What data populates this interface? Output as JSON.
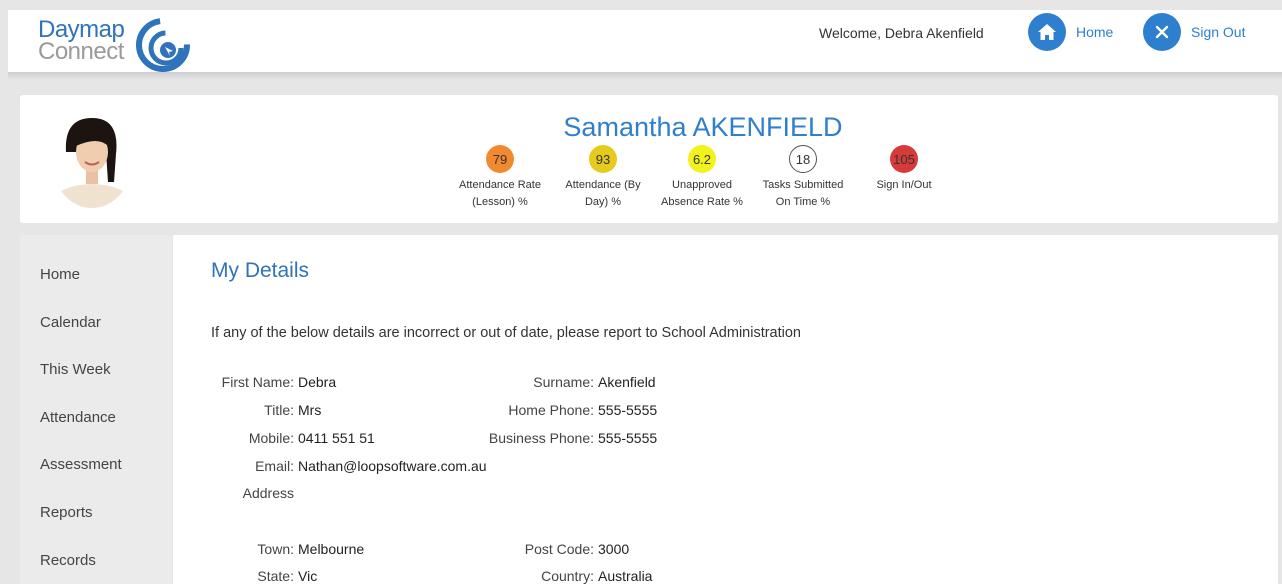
{
  "header": {
    "logo_line1": "Daymap",
    "logo_line2": "Connect",
    "welcome": "Welcome, Debra Akenfield",
    "home_label": "Home",
    "signout_label": "Sign Out",
    "accent_color": "#2f7fcf"
  },
  "student": {
    "name": "Samantha AKENFIELD",
    "stats": [
      {
        "value": "79",
        "label_line1": "Attendance Rate",
        "label_line2": "(Lesson) %",
        "color": "#f0892f"
      },
      {
        "value": "93",
        "label_line1": "Attendance (By",
        "label_line2": "Day) %",
        "color": "#e5cb1e"
      },
      {
        "value": "6.2",
        "label_line1": "Unapproved",
        "label_line2": "Absence Rate %",
        "color": "#f2f21c"
      },
      {
        "value": "18",
        "label_line1": "Tasks Submitted",
        "label_line2": "On Time %",
        "color": "#ffffff"
      },
      {
        "value": "105",
        "label_line1": "Sign In/Out",
        "label_line2": "",
        "color": "#d83a3a"
      }
    ]
  },
  "sidebar": {
    "items": [
      {
        "label": "Home"
      },
      {
        "label": "Calendar"
      },
      {
        "label": "This Week"
      },
      {
        "label": "Attendance"
      },
      {
        "label": "Assessment"
      },
      {
        "label": "Reports"
      },
      {
        "label": "Records"
      }
    ]
  },
  "main": {
    "title": "My Details",
    "notice": "If any of the below details are incorrect or out of date, please report to School Administration",
    "fields": {
      "first_name": {
        "label": "First Name:",
        "value": "Debra"
      },
      "surname": {
        "label": "Surname:",
        "value": "Akenfield"
      },
      "title": {
        "label": "Title:",
        "value": "Mrs"
      },
      "home_phone": {
        "label": "Home Phone:",
        "value": "555-5555"
      },
      "mobile": {
        "label": "Mobile:",
        "value": "0411 551 51"
      },
      "business_phone": {
        "label": "Business Phone:",
        "value": "555-5555"
      },
      "email": {
        "label": "Email:",
        "value": "Nathan@loopsoftware.com.au"
      },
      "address": {
        "label": "Address",
        "value": ""
      },
      "town": {
        "label": "Town:",
        "value": "Melbourne"
      },
      "post_code": {
        "label": "Post Code:",
        "value": "3000"
      },
      "state": {
        "label": "State:",
        "value": "Vic"
      },
      "country": {
        "label": "Country:",
        "value": "Australia"
      }
    }
  }
}
